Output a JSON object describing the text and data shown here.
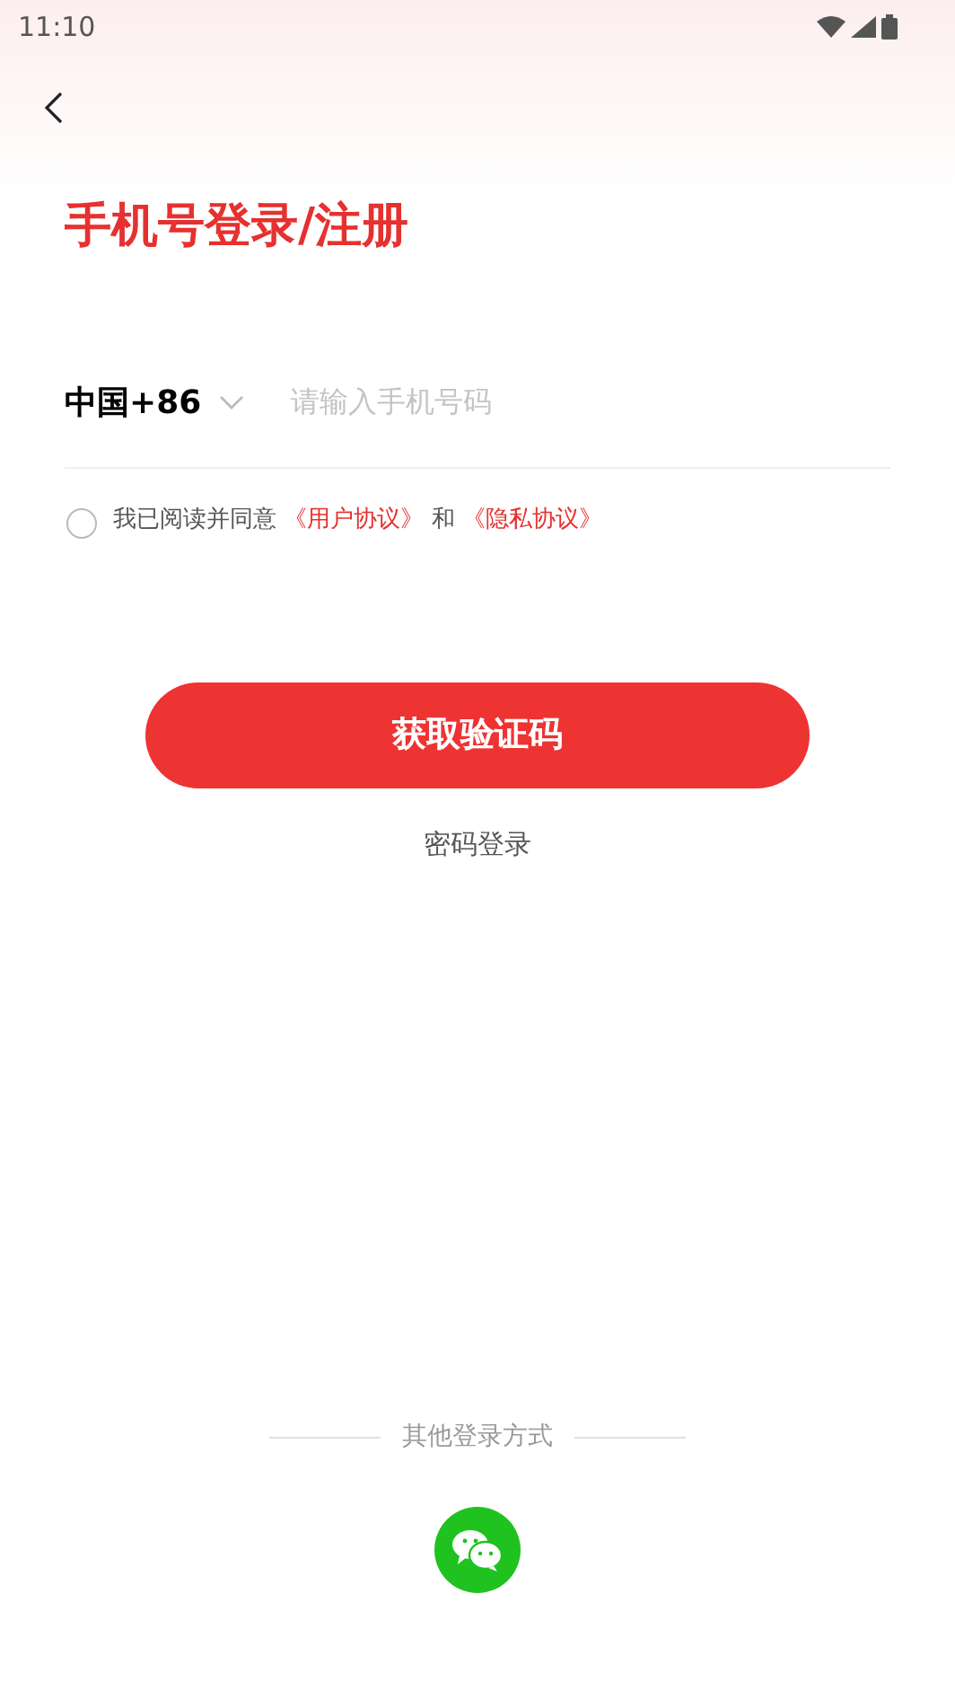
{
  "status_bar": {
    "time": "11:10"
  },
  "title": "手机号登录/注册",
  "phone": {
    "country_code": "中国+86",
    "placeholder": "请输入手机号码"
  },
  "agreement": {
    "checked": false,
    "text": "我已阅读并同意",
    "links": [
      "《用户协议》",
      "《隐私协议》"
    ],
    "conjunction": "和"
  },
  "primary_button": "获取验证码",
  "password_login": "密码登录",
  "other_login": {
    "label": "其他登录方式"
  }
}
